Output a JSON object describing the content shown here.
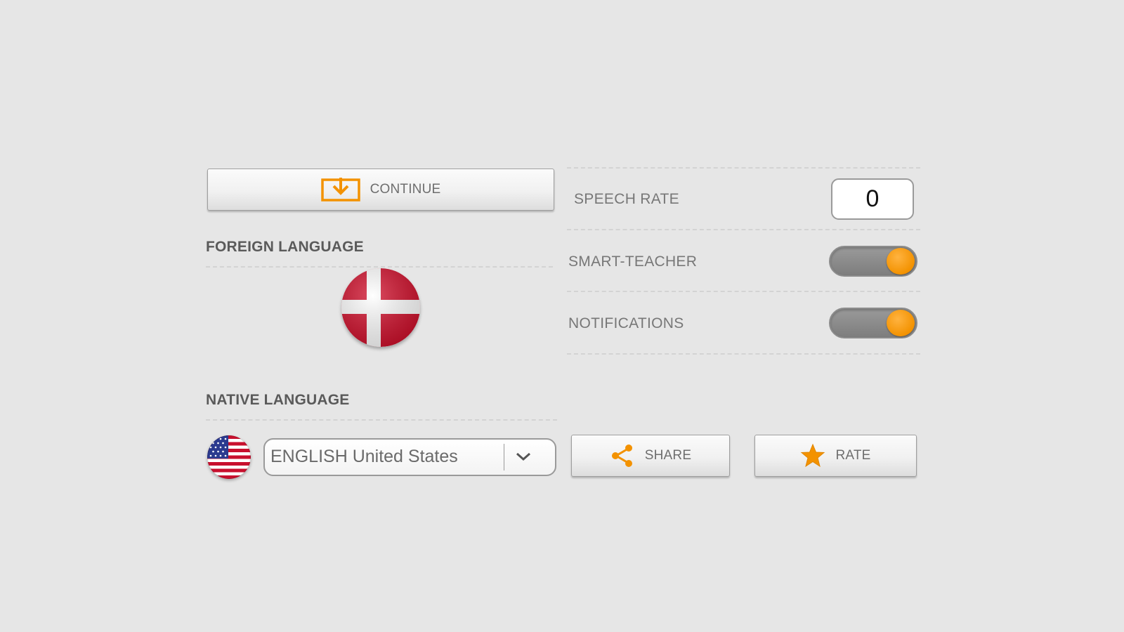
{
  "continue_button": {
    "label": "CONTINUE",
    "icon": "download-tray-icon"
  },
  "foreign_language": {
    "heading": "FOREIGN LANGUAGE",
    "flag": "denmark-flag-icon"
  },
  "native_language": {
    "heading": "NATIVE LANGUAGE",
    "flag": "usa-flag-icon",
    "selected": "ENGLISH United States"
  },
  "settings": {
    "speech_rate": {
      "label": "SPEECH RATE",
      "value": "0"
    },
    "smart_teacher": {
      "label": "SMART-TEACHER",
      "enabled": true
    },
    "notifications": {
      "label": "NOTIFICATIONS",
      "enabled": true
    }
  },
  "share_button": {
    "label": "SHARE",
    "icon": "share-icon"
  },
  "rate_button": {
    "label": "RATE",
    "icon": "star-icon"
  },
  "colors": {
    "background": "#e6e6e6",
    "accent": "#f39200",
    "flag_red": "#d0102c"
  }
}
